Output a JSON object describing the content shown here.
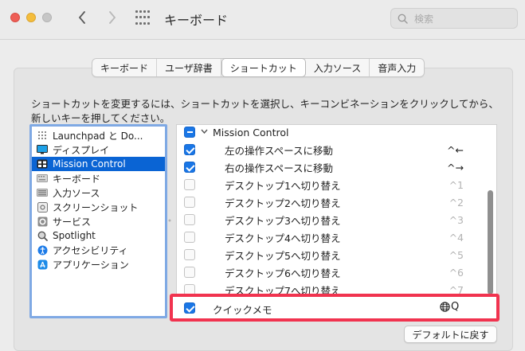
{
  "window": {
    "title": "キーボード",
    "search_placeholder": "検索"
  },
  "tabs": [
    {
      "label": "キーボード",
      "active": false
    },
    {
      "label": "ユーザ辞書",
      "active": false
    },
    {
      "label": "ショートカット",
      "active": true
    },
    {
      "label": "入力ソース",
      "active": false
    },
    {
      "label": "音声入力",
      "active": false
    }
  ],
  "instruction": "ショートカットを変更するには、ショートカットを選択し、キーコンビネーションをクリックしてから、新しいキーを押してください。",
  "sidebar": {
    "items": [
      {
        "label": "Launchpad と Do...",
        "icon": "launchpad-icon"
      },
      {
        "label": "ディスプレイ",
        "icon": "display-icon"
      },
      {
        "label": "Mission Control",
        "icon": "mission-control-icon",
        "selected": true
      },
      {
        "label": "キーボード",
        "icon": "keyboard-icon"
      },
      {
        "label": "入力ソース",
        "icon": "input-source-icon"
      },
      {
        "label": "スクリーンショット",
        "icon": "screenshot-icon"
      },
      {
        "label": "サービス",
        "icon": "services-gear-icon"
      },
      {
        "label": "Spotlight",
        "icon": "spotlight-icon"
      },
      {
        "label": "アクセシビリティ",
        "icon": "accessibility-icon"
      },
      {
        "label": "アプリケーション",
        "icon": "app-store-icon"
      }
    ]
  },
  "shortcuts": {
    "group_label": "Mission Control",
    "rows": [
      {
        "label": "左の操作スペースに移動",
        "key": "^←",
        "checked": true
      },
      {
        "label": "右の操作スペースに移動",
        "key": "^→",
        "checked": true
      },
      {
        "label": "デスクトップ1へ切り替え",
        "key": "^1",
        "checked": false
      },
      {
        "label": "デスクトップ2へ切り替え",
        "key": "^2",
        "checked": false
      },
      {
        "label": "デスクトップ3へ切り替え",
        "key": "^3",
        "checked": false
      },
      {
        "label": "デスクトップ4へ切り替え",
        "key": "^4",
        "checked": false
      },
      {
        "label": "デスクトップ5へ切り替え",
        "key": "^5",
        "checked": false
      },
      {
        "label": "デスクトップ6へ切り替え",
        "key": "^6",
        "checked": false
      },
      {
        "label": "デスクトップ7へ切り替え",
        "key": "^7",
        "checked": false
      }
    ],
    "highlighted": {
      "label": "クイックメモ",
      "key": "Q",
      "checked": true,
      "key_icon": "globe-icon"
    }
  },
  "buttons": {
    "restore_default": "デフォルトに戻す"
  },
  "colors": {
    "accent": "#1976e6",
    "selection": "#0a64d4",
    "highlight_border": "#f1334f"
  }
}
